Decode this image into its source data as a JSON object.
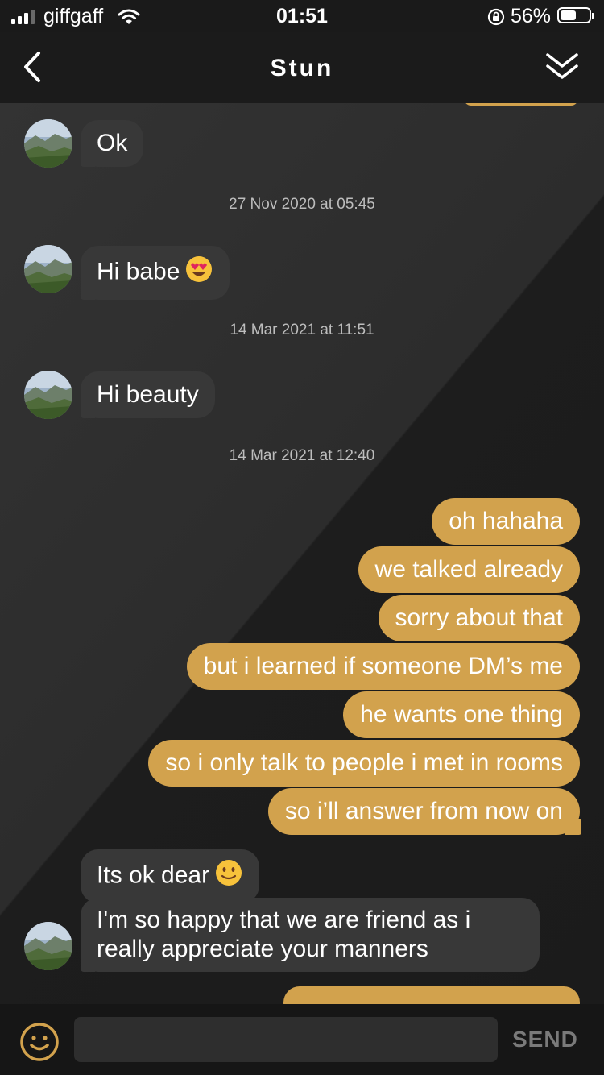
{
  "status_bar": {
    "carrier": "giffgaff",
    "time": "01:51",
    "battery_percent": "56%",
    "battery_level": 0.56,
    "icons": [
      "signal-bars-icon",
      "wifi-icon",
      "rotation-lock-icon",
      "battery-icon"
    ]
  },
  "header": {
    "title": "Stun",
    "back_icon": "chevron-left-icon",
    "collapse_icon": "double-chevron-down-icon"
  },
  "messages": [
    {
      "direction": "in",
      "text": "Ok"
    },
    {
      "timestamp": "27 Nov 2020 at 05:45"
    },
    {
      "direction": "in",
      "text": "Hi babe",
      "emoji": "heart-eyes-emoji"
    },
    {
      "timestamp": "14 Mar 2021 at 11:51"
    },
    {
      "direction": "in",
      "text": "Hi beauty"
    },
    {
      "timestamp": "14 Mar 2021 at 12:40"
    },
    {
      "direction": "out",
      "text": "oh hahaha"
    },
    {
      "direction": "out",
      "text": "we talked already"
    },
    {
      "direction": "out",
      "text": "sorry about that"
    },
    {
      "direction": "out",
      "text": "but i learned if someone DM’s me"
    },
    {
      "direction": "out",
      "text": "he wants one thing"
    },
    {
      "direction": "out",
      "text": "so i only talk to people i met in rooms"
    },
    {
      "direction": "out",
      "text": "so i’ll answer from now on"
    },
    {
      "direction": "in",
      "text": "Its ok dear",
      "emoji": "slight-smile-emoji"
    },
    {
      "direction": "in",
      "text": "I'm so happy that we are friend as i really appreciate your manners"
    }
  ],
  "composer": {
    "emoji_icon": "smiley-icon",
    "input_value": "",
    "send_label": "SEND"
  },
  "colors": {
    "accent": "#d2a24d",
    "incoming_bubble": "#383838",
    "background": "#1b1b1b"
  }
}
